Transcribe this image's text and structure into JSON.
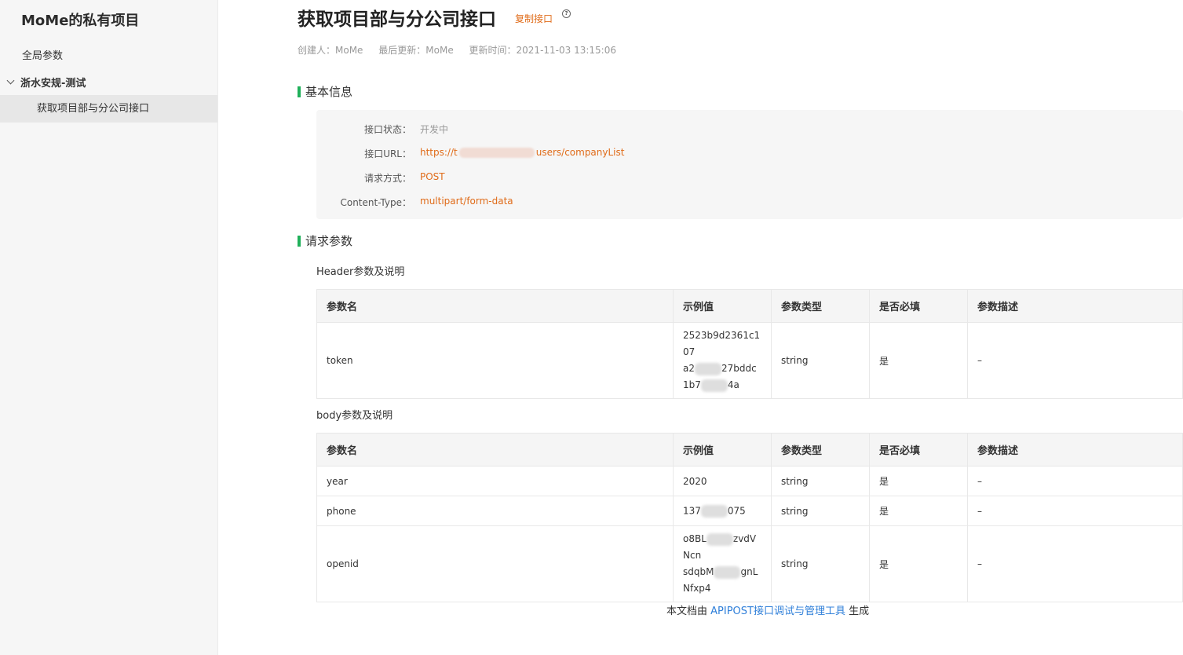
{
  "sidebar": {
    "project_title": "MoMe的私有项目",
    "global_params": "全局参数",
    "folder": "浙水安规-测试",
    "active_item": "获取项目部与分公司接口"
  },
  "doc": {
    "title": "获取项目部与分公司接口",
    "copy_label": "复制接口",
    "help_icon": "?",
    "creator": "创建人：MoMe",
    "last_updater": "最后更新：MoMe",
    "updated_time": "更新时间：2021-11-03 13:15:06"
  },
  "basic_info": {
    "heading": "基本信息",
    "status_label": "接口状态：",
    "status_value": "开发中",
    "url_label": "接口URL：",
    "url_prefix": "https://t",
    "url_suffix": "users/companyList",
    "method_label": "请求方式：",
    "method_value": "POST",
    "content_type_label": "Content-Type：",
    "content_type_value": "multipart/form-data"
  },
  "request_params": {
    "heading": "请求参数",
    "header_title": "Header参数及说明",
    "body_title": "body参数及说明",
    "columns": [
      "参数名",
      "示例值",
      "参数类型",
      "是否必填",
      "参数描述"
    ],
    "header_rows": [
      {
        "name": "token",
        "example_lines": [
          "2523b9d2361c107",
          "a2",
          "27bddc",
          "1b7",
          "4a"
        ],
        "type": "string",
        "required": "是",
        "desc": "–"
      }
    ],
    "body_rows": [
      {
        "name": "year",
        "example": "2020",
        "type": "string",
        "required": "是",
        "desc": "–"
      },
      {
        "name": "phone",
        "example_a": "137",
        "example_b": "075",
        "type": "string",
        "required": "是",
        "desc": "–"
      },
      {
        "name": "openid",
        "example_a": "o8BL",
        "example_b": "zvdVNcn",
        "example_c": "sdqbM",
        "example_d": "gnLNfxp4",
        "type": "string",
        "required": "是",
        "desc": "–"
      }
    ]
  },
  "footer": {
    "prefix": "本文档由",
    "link": "APIPOST接口调试与管理工具",
    "suffix": "生成"
  }
}
